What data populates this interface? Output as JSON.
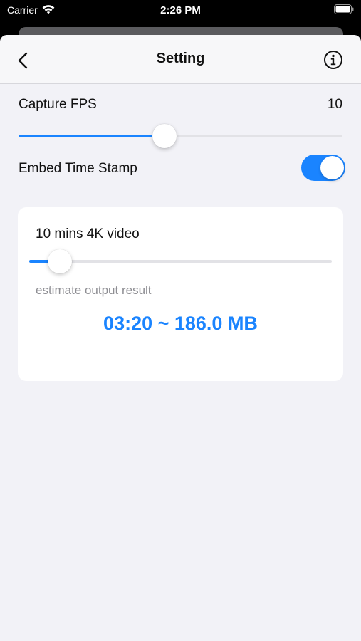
{
  "status_bar": {
    "carrier": "Carrier",
    "time": "2:26 PM"
  },
  "nav": {
    "title": "Setting",
    "back_icon": "chevron-left-icon",
    "info_icon": "info-circle-icon"
  },
  "capture_fps": {
    "label": "Capture FPS",
    "value": "10",
    "slider_fraction": 0.45
  },
  "time_stamp": {
    "label": "Embed Time Stamp",
    "enabled": true
  },
  "estimate_card": {
    "title": "10 mins 4K video",
    "slider_fraction": 0.1,
    "estimate_label": "estimate output result",
    "result": "03:20 ~ 186.0 MB"
  },
  "colors": {
    "accent": "#1a84ff",
    "background": "#f2f2f7",
    "card": "#ffffff",
    "secondary_text": "#8e8e93"
  }
}
